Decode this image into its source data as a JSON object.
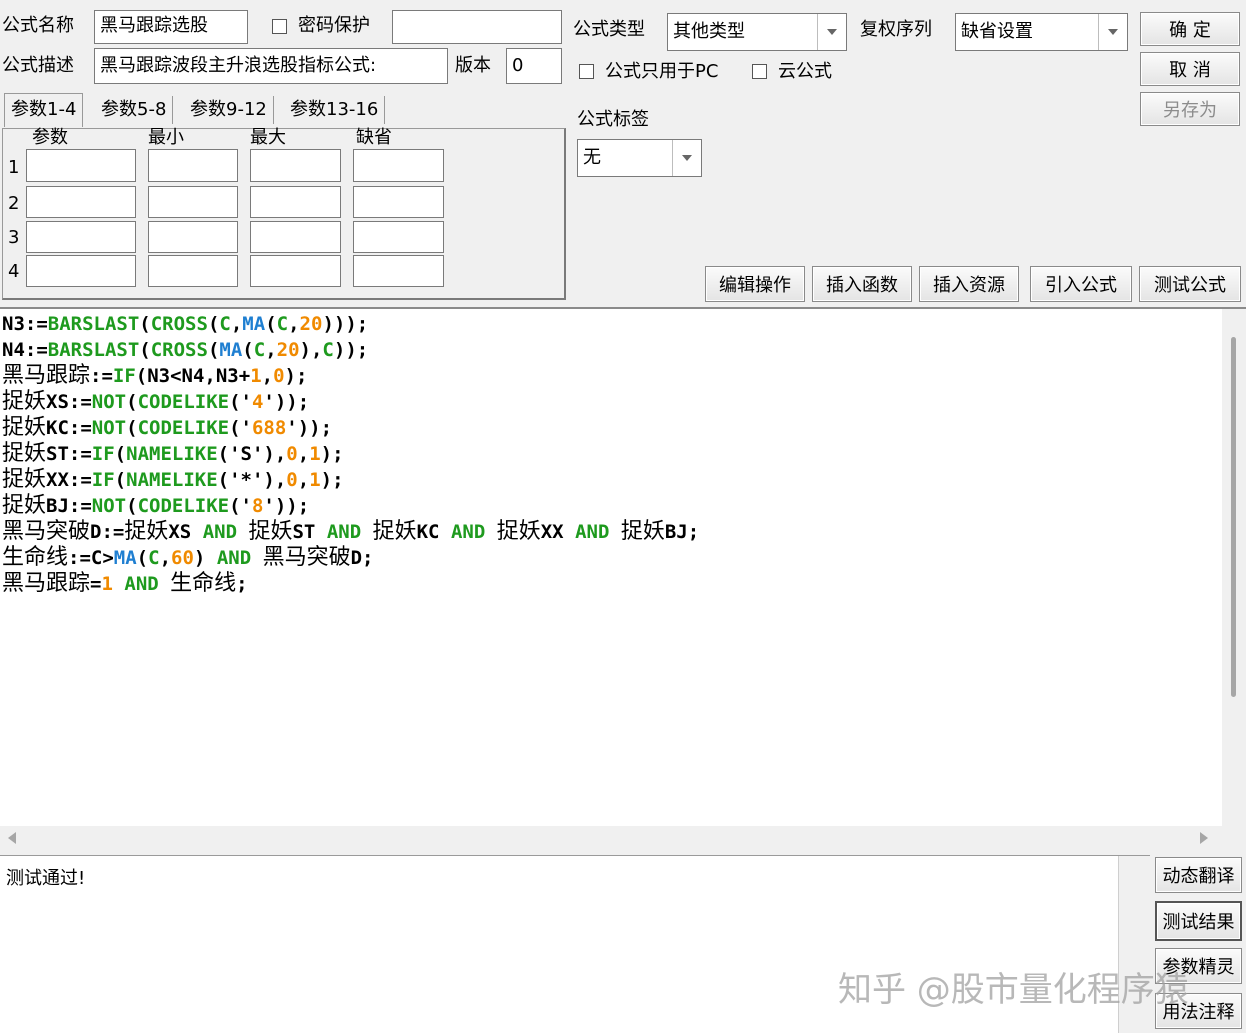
{
  "header": {
    "name_label": "公式名称",
    "name_value": "黑马跟踪选股",
    "password_label": "密码保护",
    "password_value": "",
    "desc_label": "公式描述",
    "desc_value": "黑马跟踪波段主升浪选股指标公式:",
    "version_label": "版本",
    "version_value": "0",
    "type_label": "公式类型",
    "type_value": "其他类型",
    "rights_label": "复权序列",
    "rights_value": "缺省设置",
    "pc_only_label": "公式只用于PC",
    "cloud_label": "云公式",
    "tag_label": "公式标签",
    "tag_value": "无"
  },
  "buttons": {
    "ok": "确 定",
    "cancel": "取 消",
    "save_as": "另存为",
    "edit_ops": "编辑操作",
    "insert_func": "插入函数",
    "insert_res": "插入资源",
    "import_formula": "引入公式",
    "test_formula": "测试公式",
    "dyn_translate": "动态翻译",
    "test_result": "测试结果",
    "param_wizard": "参数精灵",
    "usage_notes": "用法注释"
  },
  "params": {
    "tabs": [
      "参数1-4",
      "参数5-8",
      "参数9-12",
      "参数13-16"
    ],
    "columns": [
      "参数",
      "最小",
      "最大",
      "缺省"
    ],
    "rows": [
      "1",
      "2",
      "3",
      "4"
    ]
  },
  "code": [
    [
      [
        "N3:=",
        "k-dark"
      ],
      [
        "BARSLAST",
        "k-green"
      ],
      [
        "(",
        "k-dark"
      ],
      [
        "CROSS",
        "k-green"
      ],
      [
        "(",
        "k-dark"
      ],
      [
        "C",
        "k-green"
      ],
      [
        ",",
        "k-dark"
      ],
      [
        "MA",
        "k-blue"
      ],
      [
        "(",
        "k-dark"
      ],
      [
        "C",
        "k-green"
      ],
      [
        ",",
        "k-dark"
      ],
      [
        "20",
        "k-orng"
      ],
      [
        ")));",
        "k-dark"
      ]
    ],
    [
      [
        "N4:=",
        "k-dark"
      ],
      [
        "BARSLAST",
        "k-green"
      ],
      [
        "(",
        "k-dark"
      ],
      [
        "CROSS",
        "k-green"
      ],
      [
        "(",
        "k-dark"
      ],
      [
        "MA",
        "k-blue"
      ],
      [
        "(",
        "k-dark"
      ],
      [
        "C",
        "k-green"
      ],
      [
        ",",
        "k-dark"
      ],
      [
        "20",
        "k-orng"
      ],
      [
        "),",
        "k-dark"
      ],
      [
        "C",
        "k-green"
      ],
      [
        "));",
        "k-dark"
      ]
    ],
    [
      [
        "黑马跟踪",
        "cjk"
      ],
      [
        ":=",
        "k-dark"
      ],
      [
        "IF",
        "k-green"
      ],
      [
        "(N3<N4,N3+",
        "k-dark"
      ],
      [
        "1",
        "k-orng"
      ],
      [
        ",",
        "k-dark"
      ],
      [
        "0",
        "k-orng"
      ],
      [
        ");",
        "k-dark"
      ]
    ],
    [
      [
        "捉妖",
        "cjk"
      ],
      [
        "XS:=",
        "k-dark"
      ],
      [
        "NOT",
        "k-green"
      ],
      [
        "(",
        "k-dark"
      ],
      [
        "CODELIKE",
        "k-green"
      ],
      [
        "('",
        "k-dark"
      ],
      [
        "4",
        "k-orng"
      ],
      [
        "'));",
        "k-dark"
      ]
    ],
    [
      [
        "捉妖",
        "cjk"
      ],
      [
        "KC:=",
        "k-dark"
      ],
      [
        "NOT",
        "k-green"
      ],
      [
        "(",
        "k-dark"
      ],
      [
        "CODELIKE",
        "k-green"
      ],
      [
        "('",
        "k-dark"
      ],
      [
        "688",
        "k-orng"
      ],
      [
        "'));",
        "k-dark"
      ]
    ],
    [
      [
        "捉妖",
        "cjk"
      ],
      [
        "ST:=",
        "k-dark"
      ],
      [
        "IF",
        "k-green"
      ],
      [
        "(",
        "k-dark"
      ],
      [
        "NAMELIKE",
        "k-green"
      ],
      [
        "('S'),",
        "k-dark"
      ],
      [
        "0",
        "k-orng"
      ],
      [
        ",",
        "k-dark"
      ],
      [
        "1",
        "k-orng"
      ],
      [
        ");",
        "k-dark"
      ]
    ],
    [
      [
        "捉妖",
        "cjk"
      ],
      [
        "XX:=",
        "k-dark"
      ],
      [
        "IF",
        "k-green"
      ],
      [
        "(",
        "k-dark"
      ],
      [
        "NAMELIKE",
        "k-green"
      ],
      [
        "('*'),",
        "k-dark"
      ],
      [
        "0",
        "k-orng"
      ],
      [
        ",",
        "k-dark"
      ],
      [
        "1",
        "k-orng"
      ],
      [
        ");",
        "k-dark"
      ]
    ],
    [
      [
        "捉妖",
        "cjk"
      ],
      [
        "BJ:=",
        "k-dark"
      ],
      [
        "NOT",
        "k-green"
      ],
      [
        "(",
        "k-dark"
      ],
      [
        "CODELIKE",
        "k-green"
      ],
      [
        "('",
        "k-dark"
      ],
      [
        "8",
        "k-orng"
      ],
      [
        "'));",
        "k-dark"
      ]
    ],
    [
      [
        "黑马突破",
        "cjk"
      ],
      [
        "D:=",
        "k-dark"
      ],
      [
        "捉妖",
        "cjk"
      ],
      [
        "XS ",
        "k-dark"
      ],
      [
        "AND",
        "k-green"
      ],
      [
        " ",
        "k-dark"
      ],
      [
        "捉妖",
        "cjk"
      ],
      [
        "ST ",
        "k-dark"
      ],
      [
        "AND",
        "k-green"
      ],
      [
        " ",
        "k-dark"
      ],
      [
        "捉妖",
        "cjk"
      ],
      [
        "KC ",
        "k-dark"
      ],
      [
        "AND",
        "k-green"
      ],
      [
        " ",
        "k-dark"
      ],
      [
        "捉妖",
        "cjk"
      ],
      [
        "XX ",
        "k-dark"
      ],
      [
        "AND",
        "k-green"
      ],
      [
        " ",
        "k-dark"
      ],
      [
        "捉妖",
        "cjk"
      ],
      [
        "BJ;",
        "k-dark"
      ]
    ],
    [
      [
        "生命线",
        "cjk"
      ],
      [
        ":=C>",
        "k-dark"
      ],
      [
        "MA",
        "k-blue"
      ],
      [
        "(",
        "k-dark"
      ],
      [
        "C",
        "k-green"
      ],
      [
        ",",
        "k-dark"
      ],
      [
        "60",
        "k-orng"
      ],
      [
        ") ",
        "k-dark"
      ],
      [
        "AND",
        "k-green"
      ],
      [
        " ",
        "k-dark"
      ],
      [
        "黑马突破",
        "cjk"
      ],
      [
        "D;",
        "k-dark"
      ]
    ],
    [
      [
        "黑马跟踪",
        "cjk"
      ],
      [
        "=",
        "k-dark"
      ],
      [
        "1",
        "k-orng"
      ],
      [
        " ",
        "k-dark"
      ],
      [
        "AND",
        "k-green"
      ],
      [
        " ",
        "k-dark"
      ],
      [
        "生命线",
        "cjk"
      ],
      [
        ";",
        "k-dark"
      ]
    ]
  ],
  "output": {
    "text": "测试通过!"
  },
  "watermark": "知乎 @股市量化程序猿"
}
